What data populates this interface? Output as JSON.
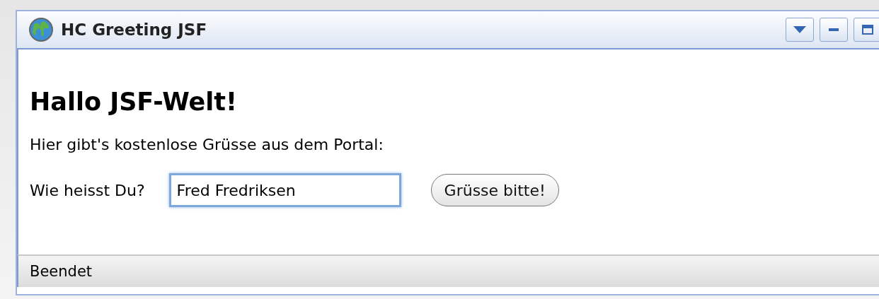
{
  "window": {
    "title": "HC Greeting JSF"
  },
  "heading": "Hallo JSF-Welt!",
  "intro": "Hier gibt's kostenlose Grüsse aus dem Portal:",
  "form": {
    "label": "Wie heisst Du?",
    "name_field": {
      "value": "Fred Fredriksen",
      "focused": true
    },
    "submit": "Grüsse bitte!"
  },
  "status_bar": "Beendet"
}
